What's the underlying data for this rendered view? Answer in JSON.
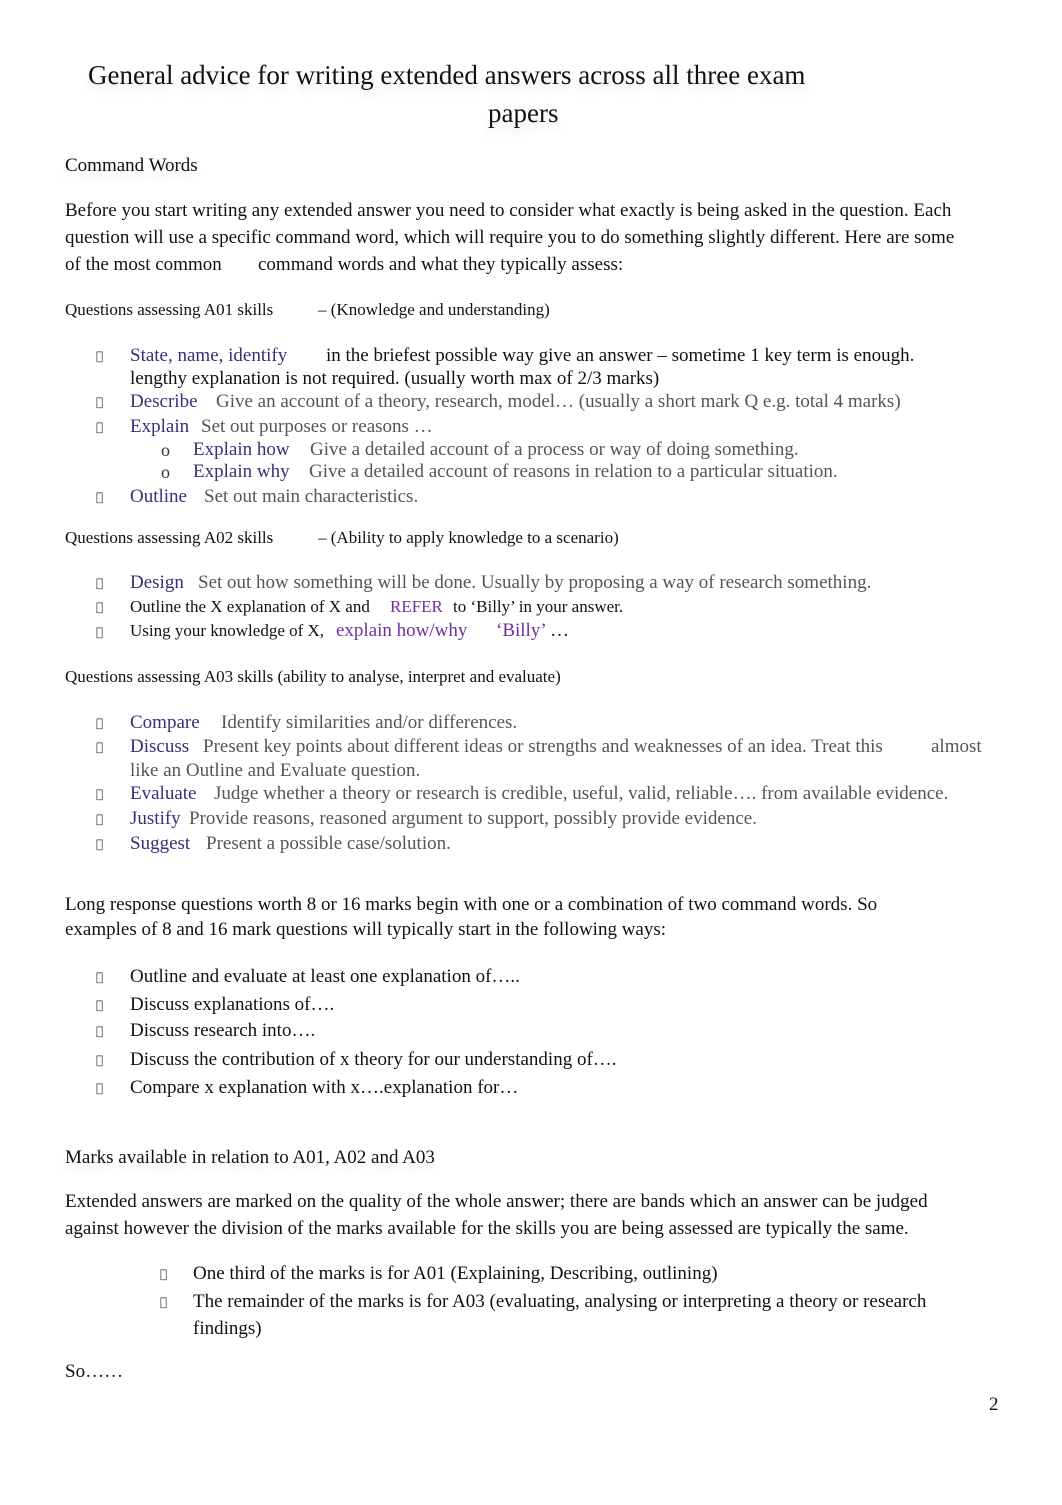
{
  "document": {
    "title_line1": "General advice for writing extended answers across all three exam",
    "title_line2": "papers",
    "command_words_heading": "Command Words",
    "intro_line1": "Before you start writing any extended answer you need to consider what exactly is being asked in the question. Each",
    "intro_line2": "question will use a specific command word, which will require you to do something slightly different. Here are some",
    "intro_line3a": "of the  most common",
    "intro_line3b": "command words and what they typically assess:",
    "bullet_glyph": "",
    "sub_bullet_glyph": "o",
    "a01": {
      "heading_a": "Questions assessing A01 skills",
      "heading_b": "–  (Knowledge and understanding)",
      "items": [
        {
          "cmd": "State, name, identify",
          "desc": "in the briefest possible way give an answer – sometime 1 key term is enough.",
          "desc2": "lengthy explanation is not required. (usually worth max of 2/3 marks)"
        },
        {
          "cmd": "Describe",
          "desc": "Give an account of a theory, research, model… (usually a short mark Q e.g. total 4 marks)"
        },
        {
          "cmd": "Explain",
          "desc": "Set out purposes or reasons   …"
        },
        {
          "cmd": "Explain how",
          "desc": "Give a detailed account of a process or way of doing something."
        },
        {
          "cmd": "Explain why",
          "desc": "Give a detailed account of reasons in relation to a particular situation."
        },
        {
          "cmd": "Outline",
          "desc": "Set out main characteristics."
        }
      ]
    },
    "a02": {
      "heading_a": "Questions assessing A02 skills",
      "heading_b": "–  (Ability to apply knowledge to a scenario)",
      "items": [
        {
          "cmd": "Design",
          "desc": "Set out how something will be done. Usually by proposing a way of research something."
        },
        {
          "pre": "Outline the X explanation of X and",
          "hl": "REFER",
          "post": "to ‘Billy’ in your answer."
        },
        {
          "pre": "Using your knowledge of X,",
          "hl": "explain how/why",
          "hl2": "‘Billy’",
          "post": "…"
        }
      ]
    },
    "a03": {
      "heading": "Questions assessing A03 skills (ability to analyse, interpret and evaluate)",
      "items": [
        {
          "cmd": "Compare",
          "desc": "Identify similarities and/or differences."
        },
        {
          "cmd": "Discuss",
          "desc": "Present key points about different ideas or strengths and weaknesses of an idea. Treat this",
          "desc_tail": "almost",
          "desc2": "like an Outline and Evaluate question."
        },
        {
          "cmd": "Evaluate",
          "desc": "Judge whether a theory or research is credible, useful, valid, reliable…. from available evidence."
        },
        {
          "cmd": "Justify",
          "desc": "Provide reasons, reasoned argument to support, possibly provide evidence."
        },
        {
          "cmd": "Suggest",
          "desc": "Present a possible case/solution."
        }
      ]
    },
    "long_response": {
      "line1": "Long response questions worth 8 or 16 marks begin with one or a combination of two command words. So",
      "line2": "examples of 8 and 16 mark questions will  typically   start in the following ways:",
      "items": [
        "Outline and evaluate at least one explanation of…..",
        "Discuss explanations of….",
        "Discuss research into….",
        "Discuss the contribution of x theory for our understanding of….",
        "Compare x explanation with x….explanation for…"
      ]
    },
    "marks": {
      "heading": "Marks available in relation to A01, A02 and A03",
      "line1": "Extended answers are marked on the quality of the whole answer; there are bands which an answer can be judged",
      "line2": "against however the division of the marks available for the skills you are being assessed are typically the same.",
      "items": [
        "One third of the marks is for A01 (Explaining, Describing, outlining)",
        "The remainder of the marks is for A03 (evaluating, analysing or interpreting a theory or research",
        "findings)"
      ],
      "so": "So……"
    },
    "page_number": "2"
  }
}
